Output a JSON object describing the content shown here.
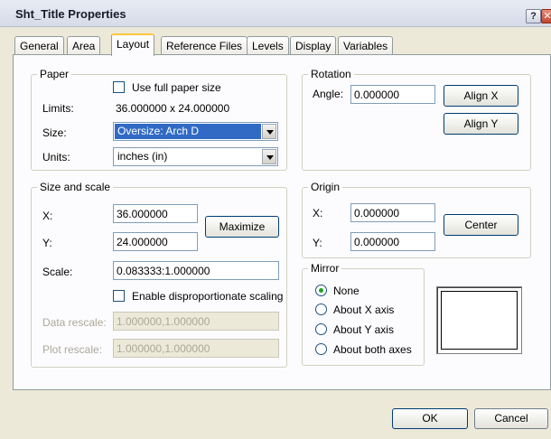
{
  "window": {
    "title": "Sht_Title Properties",
    "help_glyph": "?",
    "close_glyph": "✕"
  },
  "tabs": [
    {
      "label": "General"
    },
    {
      "label": "Area"
    },
    {
      "label": "Layout"
    },
    {
      "label": "Reference Files"
    },
    {
      "label": "Levels"
    },
    {
      "label": "Display"
    },
    {
      "label": "Variables"
    }
  ],
  "active_tab": "Layout",
  "paper": {
    "group_label": "Paper",
    "full_paper_label": "Use full paper size",
    "limits_label": "Limits:",
    "limits_value": "36.000000 x 24.000000",
    "size_label": "Size:",
    "size_value": "Oversize: Arch D",
    "units_label": "Units:",
    "units_value": "inches (in)"
  },
  "rotation": {
    "group_label": "Rotation",
    "angle_label": "Angle:",
    "angle_value": "0.000000",
    "align_x": "Align X",
    "align_y": "Align Y"
  },
  "size_scale": {
    "group_label": "Size and scale",
    "x_label": "X:",
    "x_value": "36.000000",
    "y_label": "Y:",
    "y_value": "24.000000",
    "maximize": "Maximize",
    "scale_label": "Scale:",
    "scale_value": "0.083333:1.000000",
    "disprop_label": "Enable disproportionate scaling",
    "data_rescale_label": "Data rescale:",
    "data_rescale_value": "1.000000,1.000000",
    "plot_rescale_label": "Plot rescale:",
    "plot_rescale_value": "1.000000,1.000000"
  },
  "origin": {
    "group_label": "Origin",
    "x_label": "X:",
    "x_value": "0.000000",
    "y_label": "Y:",
    "y_value": "0.000000",
    "center": "Center"
  },
  "mirror": {
    "group_label": "Mirror",
    "options": [
      "None",
      "About X axis",
      "About Y axis",
      "About both axes"
    ],
    "selected": "None"
  },
  "footer": {
    "ok": "OK",
    "cancel": "Cancel"
  },
  "colors": {
    "accent": "#ffc83c",
    "selection": "#316ac5",
    "dialog_bg": "#ece9d8"
  }
}
